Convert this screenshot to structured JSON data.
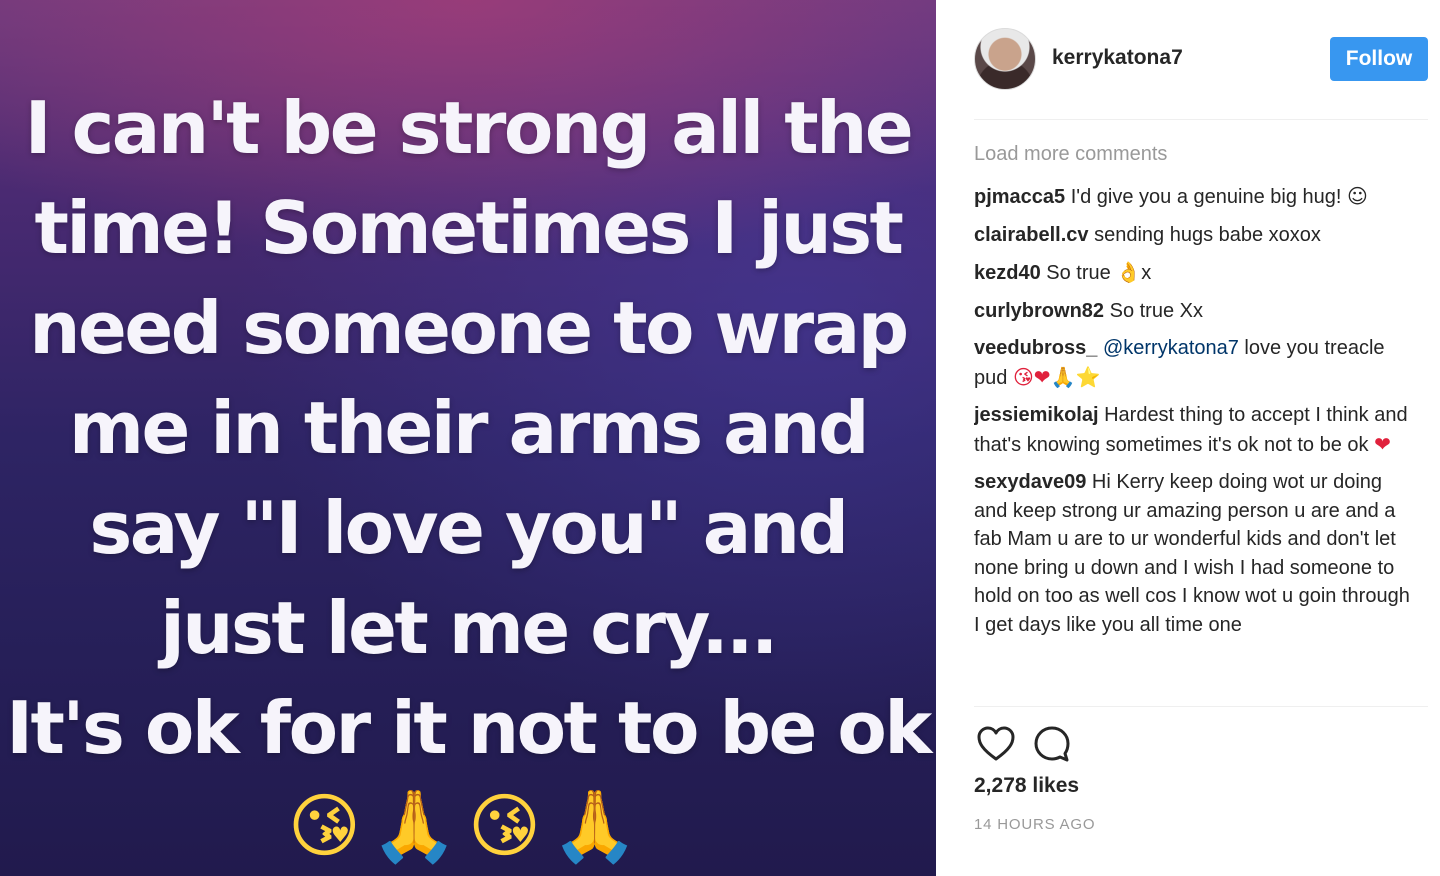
{
  "image_text": {
    "lines": [
      "I can't be strong all the",
      "time! Sometimes I just",
      "need someone to wrap",
      "me in their arms and",
      "say \"I love you\" and",
      "just let me cry...",
      "It's ok for it not to be ok"
    ],
    "emojis": "😘🙏😘🙏"
  },
  "header": {
    "username": "kerrykatona7",
    "follow_label": "Follow"
  },
  "comments": {
    "load_more_label": "Load more comments",
    "items": [
      {
        "user": "pjmacca5",
        "text": " I'd give you a genuine big hug! ",
        "emoji": "☺"
      },
      {
        "user": "clairabell.cv",
        "text": " sending hugs babe xoxox"
      },
      {
        "user": "kezd40",
        "text": " So true ",
        "emoji": "👌",
        "suffix": "x"
      },
      {
        "user": "curlybrown82",
        "text": " So true Xx"
      },
      {
        "user": "veedubross_",
        "mention": "@kerrykatona7",
        "text": " love you treacle pud ",
        "emoji": "😘❤🙏⭐"
      },
      {
        "user": "jessiemikolaj",
        "text": " Hardest thing to accept I think and that's knowing sometimes it's ok not to be ok ",
        "emoji": "❤"
      },
      {
        "user": "sexydave09",
        "text": " Hi Kerry keep doing wot ur doing and keep strong ur amazing person u are and a fab Mam u are to ur wonderful kids and don't let none bring u down and I wish I had someone to hold on too as well cos I know wot u goin through I get days like you all time one"
      }
    ]
  },
  "likes_label": "2,278 likes",
  "timestamp": "14 HOURS AGO",
  "icons": {
    "like": "heart-icon",
    "comment": "comment-bubble-icon"
  },
  "colors": {
    "follow_button": "#3897f0",
    "muted_text": "#999999",
    "heart_red": "#e0213c"
  }
}
